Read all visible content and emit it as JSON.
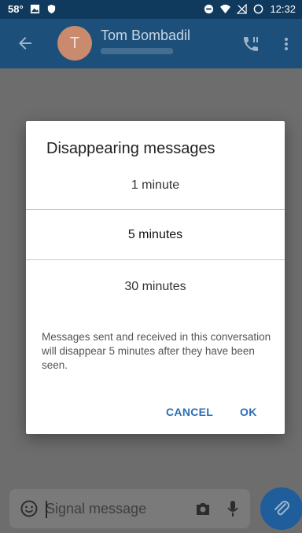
{
  "status_bar": {
    "temperature": "58°",
    "time": "12:32"
  },
  "header": {
    "avatar_initial": "T",
    "contact_name": "Tom Bombadil",
    "icons": [
      "back-arrow-icon",
      "call-icon",
      "more-vert-icon"
    ]
  },
  "dialog": {
    "title": "Disappearing messages",
    "options": [
      {
        "label": "1 minute",
        "selected": false
      },
      {
        "label": "5 minutes",
        "selected": true
      },
      {
        "label": "30 minutes",
        "selected": false
      }
    ],
    "description": "Messages sent and received in this conversation will disappear 5 minutes after they have been seen.",
    "cancel_label": "CANCEL",
    "ok_label": "OK"
  },
  "compose": {
    "placeholder": "Signal message",
    "icons": [
      "emoji-icon",
      "camera-icon",
      "mic-icon",
      "attach-icon"
    ]
  },
  "colors": {
    "status_bar": "#0f3a5e",
    "app_bar": "#1c4f7a",
    "accent": "#2c6fb4",
    "overlay": "#6d6d6d"
  }
}
